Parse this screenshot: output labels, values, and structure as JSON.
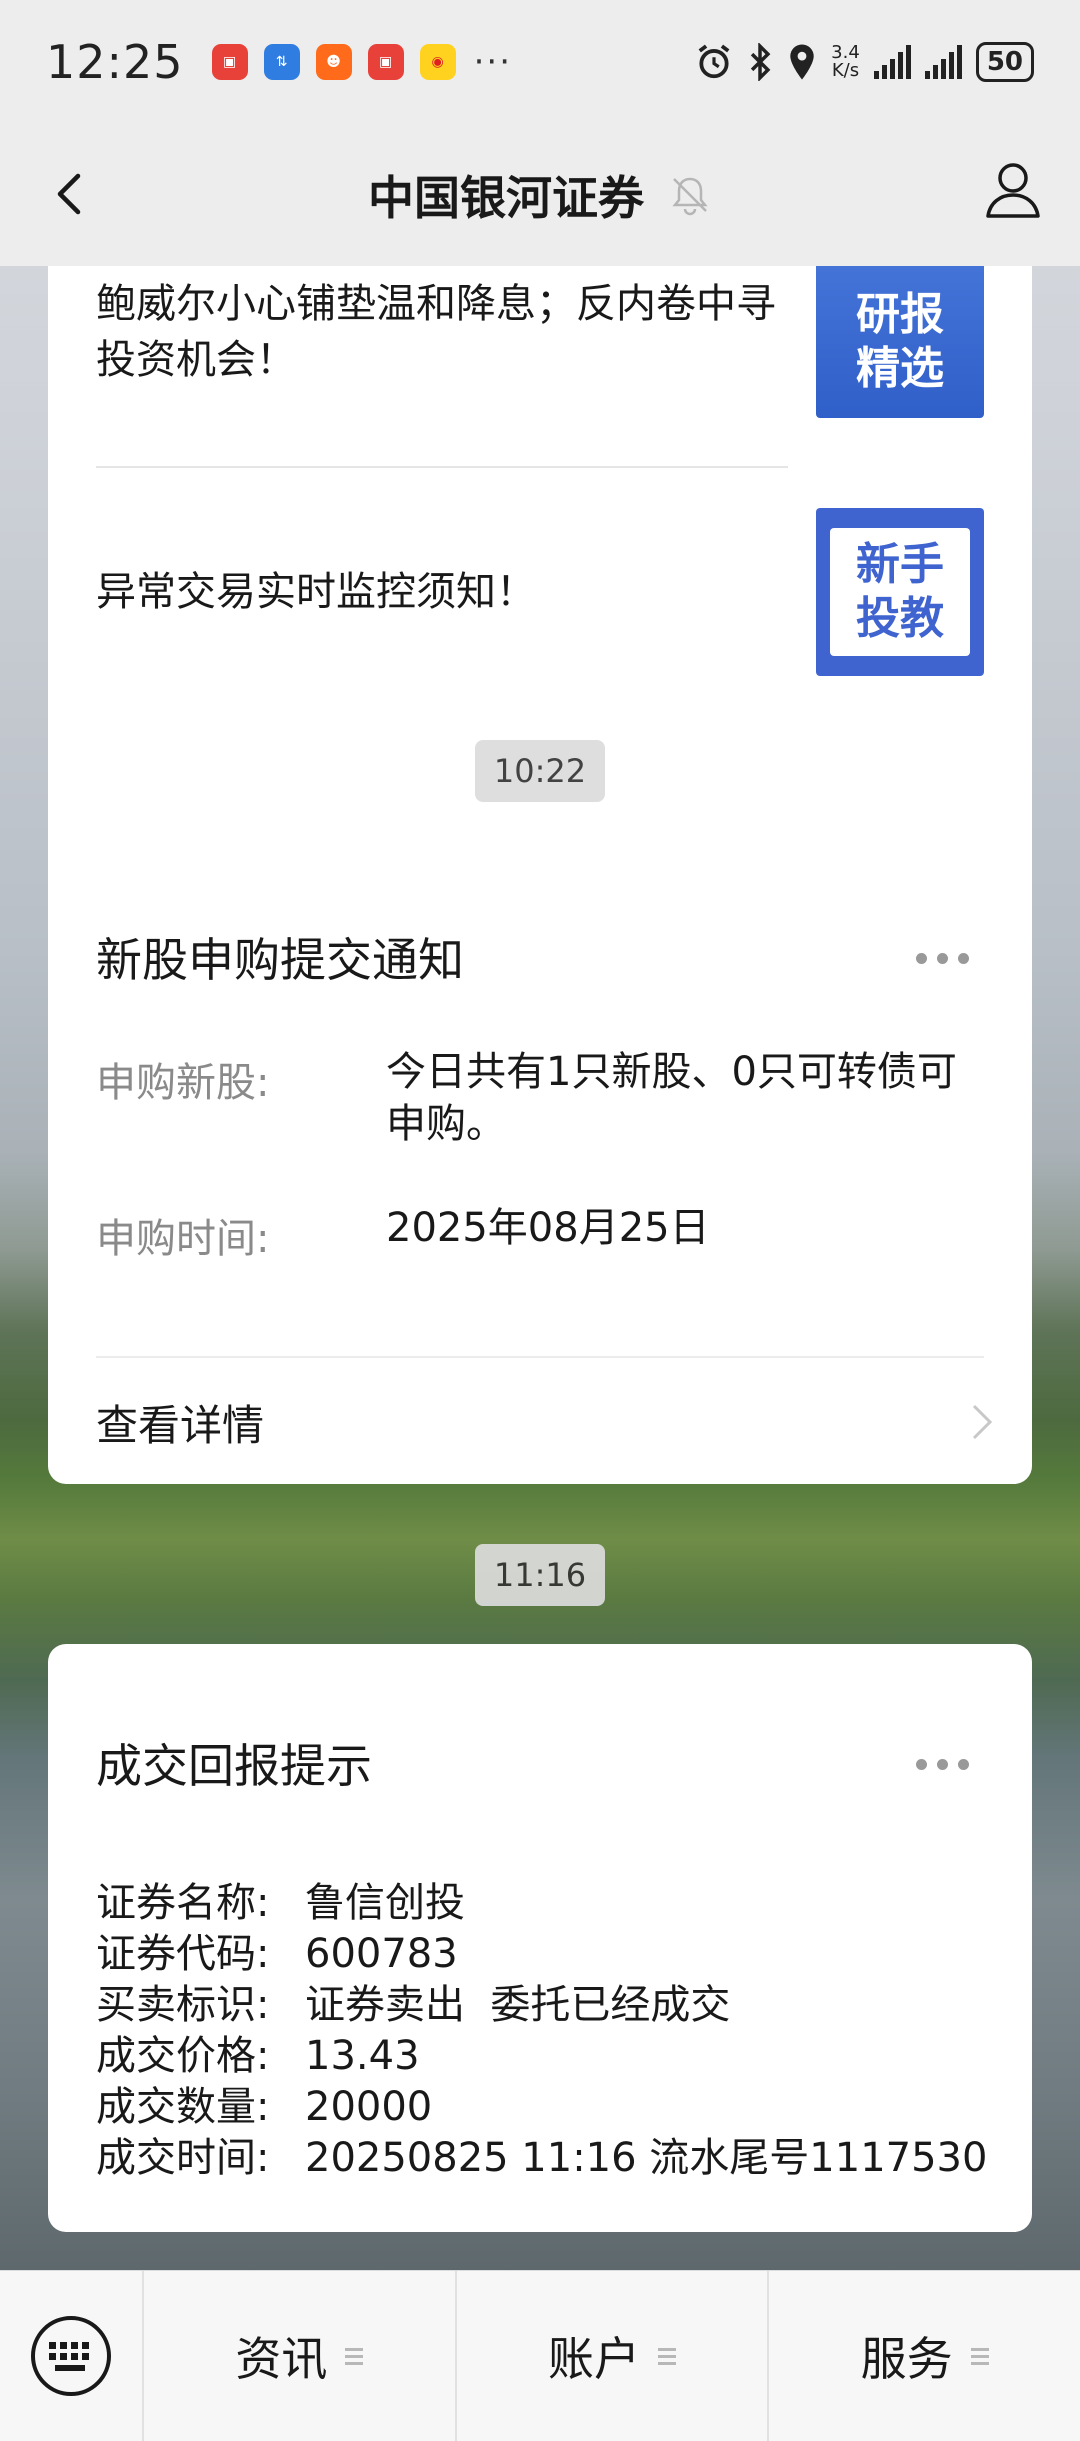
{
  "status_bar": {
    "time": "12:25",
    "net_speed_value": "3.4",
    "net_speed_unit": "K/s",
    "battery": "50",
    "app_icons": [
      "huawei-appgallery-icon",
      "transfer-icon",
      "taobao-icon",
      "huawei-appgallery-icon",
      "weibo-icon"
    ],
    "more_dots": "···"
  },
  "nav": {
    "title": "中国银河证券",
    "muted": true
  },
  "news": [
    {
      "text": "鲍威尔小心铺垫温和降息；反内卷中寻投资机会！",
      "thumb_line1": "研报",
      "thumb_line2": "精选",
      "thumb_color": "#3f6fd6"
    },
    {
      "text": "异常交易实时监控须知！",
      "thumb_line1": "新手",
      "thumb_line2": "投教",
      "thumb_color": "#3f64cf"
    }
  ],
  "timestamps": [
    "10:22",
    "11:16"
  ],
  "ipo_card": {
    "title": "新股申购提交通知",
    "rows": [
      {
        "label": "申购新股:",
        "value": "今日共有1只新股、0只可转债可申购。"
      },
      {
        "label": "申购时间:",
        "value": "2025年08月25日"
      }
    ],
    "detail_label": "查看详情"
  },
  "trade_card": {
    "title": "成交回报提示",
    "lines": [
      {
        "label": "证券名称:",
        "value": "鲁信创投"
      },
      {
        "label": "证券代码:",
        "value": "600783"
      },
      {
        "label": "买卖标识:",
        "value": "证券卖出  委托已经成交"
      },
      {
        "label": "成交价格:",
        "value": "13.43"
      },
      {
        "label": "成交数量:",
        "value": "20000"
      },
      {
        "label": "成交时间:",
        "value": "20250825 11:16 流水尾号1117530"
      }
    ]
  },
  "bottom_tabs": [
    {
      "label": "资讯"
    },
    {
      "label": "账户"
    },
    {
      "label": "服务"
    }
  ]
}
